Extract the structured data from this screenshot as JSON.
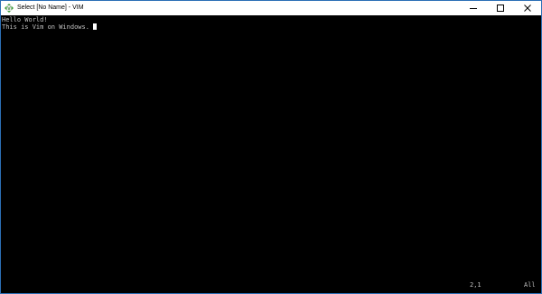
{
  "window": {
    "title": "Select [No Name] - VIM",
    "icon": "vim-icon",
    "controls": [
      "minimize-icon",
      "maximize-icon",
      "close-icon"
    ]
  },
  "editor": {
    "lines": [
      {
        "text": "Hello World!"
      },
      {
        "text": "This is Vim on Windows. "
      }
    ],
    "cursor_line": 2
  },
  "status": {
    "position": "2,1",
    "view": "All"
  },
  "colors": {
    "background": "#000000",
    "text": "#c0c0c0",
    "cursor": "#ffffff",
    "titlebar": "#ffffff",
    "border": "#2b6fb6"
  }
}
